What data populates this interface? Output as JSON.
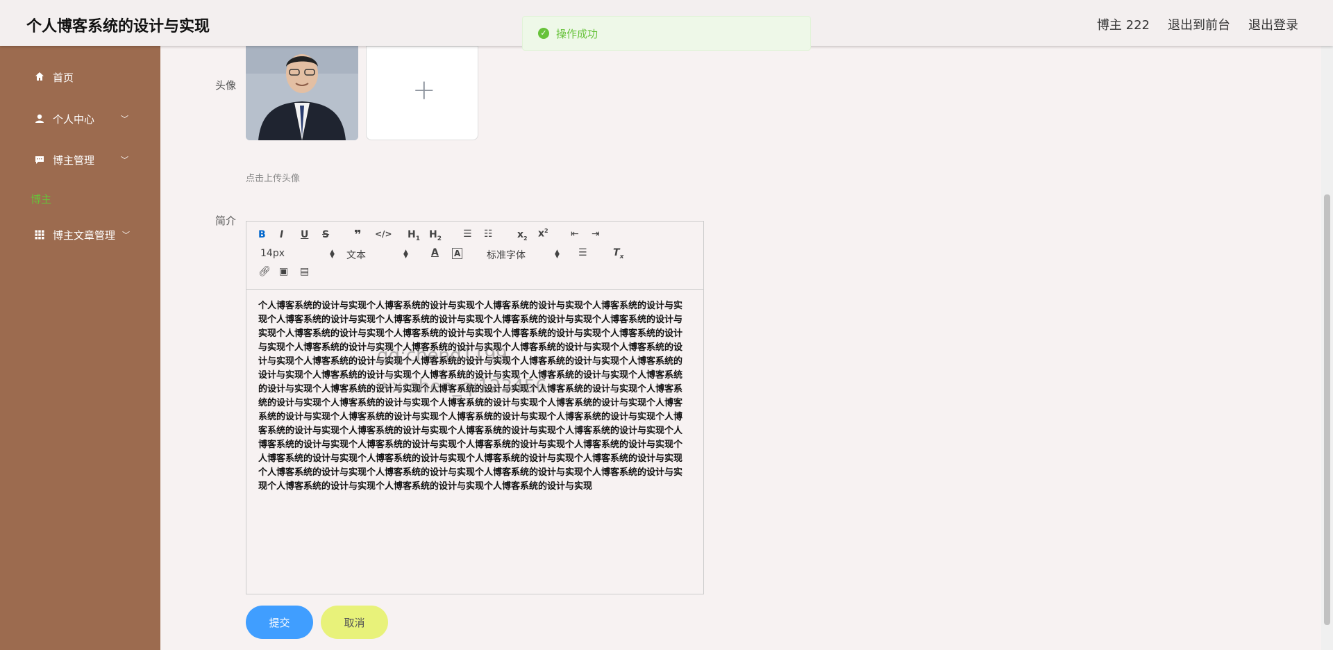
{
  "header": {
    "title": "个人博客系统的设计与实现",
    "user": "博主 222",
    "to_front": "退出到前台",
    "logout": "退出登录"
  },
  "toast": {
    "message": "操作成功"
  },
  "sidebar": {
    "items": [
      {
        "label": "首页",
        "icon": "home-icon"
      },
      {
        "label": "个人中心",
        "icon": "user-icon"
      },
      {
        "label": "博主管理",
        "icon": "chat-icon"
      },
      {
        "label": "博主",
        "icon": ""
      },
      {
        "label": "博主文章管理",
        "icon": "grid-icon"
      }
    ]
  },
  "form": {
    "avatar_label": "头像",
    "upload_hint": "点击上传头像",
    "intro_label": "简介",
    "submit": "提交",
    "cancel": "取消"
  },
  "editor": {
    "toolbar": {
      "font_size": "14px",
      "header": "文本",
      "font": "标准字体"
    },
    "content": "个人博客系统的设计与实现个人博客系统的设计与实现个人博客系统的设计与实现个人博客系统的设计与实现个人博客系统的设计与实现个人博客系统的设计与实现个人博客系统的设计与实现个人博客系统的设计与实现个人博客系统的设计与实现个人博客系统的设计与实现个人博客系统的设计与实现个人博客系统的设计与实现个人博客系统的设计与实现个人博客系统的设计与实现个人博客系统的设计与实现个人博客系统的设计与实现个人博客系统的设计与实现个人博客系统的设计与实现个人博客系统的设计与实现个人博客系统的设计与实现个人博客系统的设计与实现个人博客系统的设计与实现个人博客系统的设计与实现个人博客系统的设计与实现个人博客系统的设计与实现个人博客系统的设计与实现个人博客系统的设计与实现个人博客系统的设计与实现个人博客系统的设计与实现个人博客系统的设计与实现个人博客系统的设计与实现个人博客系统的设计与实现个人博客系统的设计与实现个人博客系统的设计与实现个人博客系统的设计与实现个人博客系统的设计与实现个人博客系统的设计与实现个人博客系统的设计与实现个人博客系统的设计与实现个人博客系统的设计与实现个人博客系统的设计与实现个人博客系统的设计与实现个人博客系统的设计与实现个人博客系统的设计与实现个人博客系统的设计与实现个人博客系统的设计与实现个人博客系统的设计与实现个人博客系统的设计与实现个人博客系统的设计与实现个人博客系统的设计与实现个人博客系统的设计与实现个人博客系统的设计与实现个人博客系统的设计与实现个人博客系统的设计与实现",
    "watermark_1": "qq:chend1199",
    "watermark_2": "wx:chen_qi123456"
  },
  "colors": {
    "sidebar_bg": "#9c6b4f",
    "accent_blue": "#409eff",
    "cancel_yellow": "#e8f27a",
    "success_green": "#67c23a"
  }
}
